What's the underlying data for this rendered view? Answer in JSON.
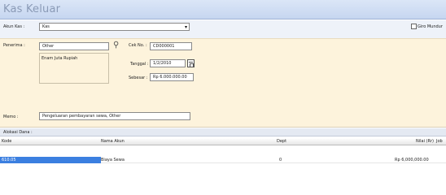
{
  "window": {
    "title": "Kas Keluar"
  },
  "account": {
    "label": "Akun Kas :",
    "value": "Kas",
    "post_dated_label": "Giro Mundur"
  },
  "form": {
    "payee_label": "Penerima :",
    "payee_value": "Other",
    "amount_words": "Enam Juta Rupiah",
    "check_no_label": "Cek No. :",
    "check_no_value": "CD000001",
    "date_label": "Tanggal :",
    "date_value": "1/2/2010",
    "total_label": "Sebesar :",
    "total_value": "Rp 6.000.000.00",
    "memo_label": "Memo :",
    "memo_value": "Pengeluaran pembayaran sewa, Other"
  },
  "allocation": {
    "title": "Alokasi Dana :",
    "columns": [
      "Kode",
      "Nama Akun",
      "Dept",
      "Nilai (Rr)",
      "Job"
    ],
    "rows": [
      {
        "code": "610.05",
        "name": "Biaya Sewa",
        "dept": "0",
        "value": "Rp 6,000,000.00"
      }
    ]
  },
  "icons": [
    "person-icon",
    "calendar-icon",
    "chevron-down-icon"
  ]
}
